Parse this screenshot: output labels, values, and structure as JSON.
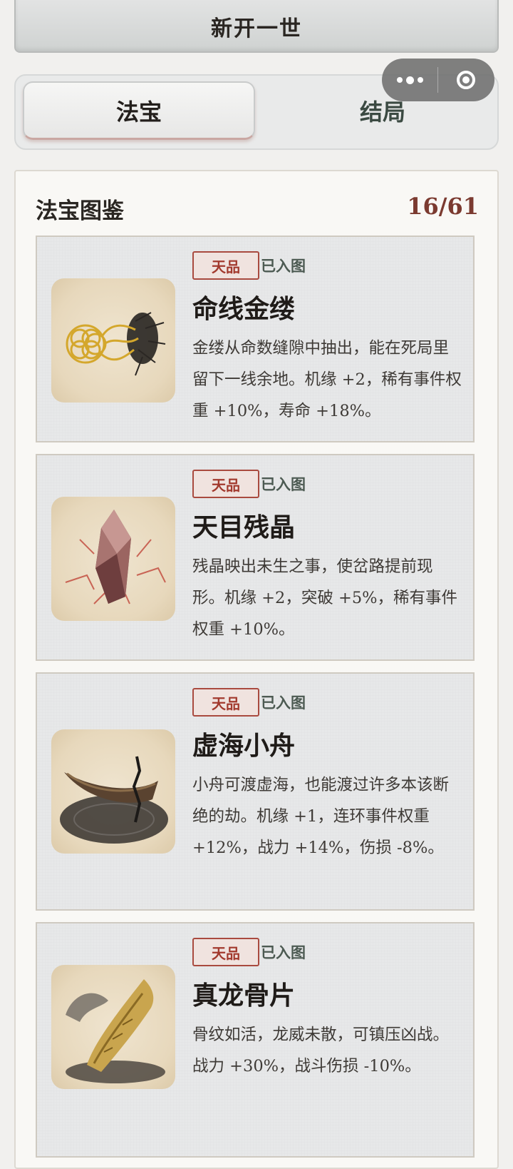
{
  "header": {
    "new_life_label": "新开一世"
  },
  "tabs": [
    {
      "label": "法宝",
      "active": true
    },
    {
      "label": "结局",
      "active": false
    }
  ],
  "capsule": {
    "more_icon": "more-dots-icon",
    "close_icon": "target-circle-icon"
  },
  "codex": {
    "title": "法宝图鉴",
    "count": "16/61",
    "items": [
      {
        "grade": "天品",
        "status": "已入图",
        "name": "命线金缕",
        "desc": "金缕从命数缝隙中抽出，能在死局里留下一线余地。机缘 +2，稀有事件权重 +10%，寿命 +18%。",
        "image": "golden-thread-icon"
      },
      {
        "grade": "天品",
        "status": "已入图",
        "name": "天目残晶",
        "desc": "残晶映出未生之事，使岔路提前现形。机缘 +2，突破 +5%，稀有事件权重 +10%。",
        "image": "red-crystal-icon"
      },
      {
        "grade": "天品",
        "status": "已入图",
        "name": "虚海小舟",
        "desc": "小舟可渡虚海，也能渡过许多本该断绝的劫。机缘 +1，连环事件权重 +12%，战力 +14%，伤损 -8%。",
        "image": "void-boat-icon"
      },
      {
        "grade": "天品",
        "status": "已入图",
        "name": "真龙骨片",
        "desc": "骨纹如活，龙威未散，可镇压凶战。战力 +30%，战斗伤损 -10%。",
        "image": "dragon-bone-icon"
      }
    ]
  },
  "colors": {
    "accent_red": "#a23a2e",
    "count_color": "#7b3a30",
    "status_green": "#4c5a52"
  }
}
